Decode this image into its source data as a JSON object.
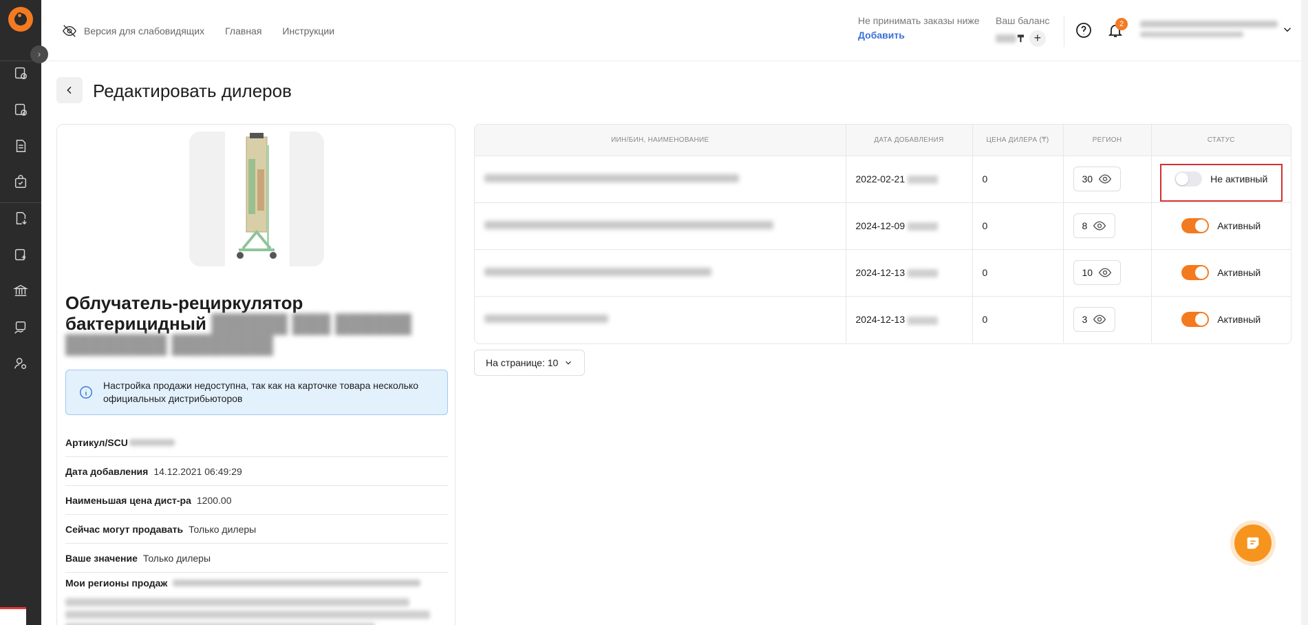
{
  "header": {
    "accessibility_label": "Версия для слабовидящих",
    "nav": [
      "Главная",
      "Инструкции"
    ],
    "min_orders_label": "Не принимать заказы ниже",
    "min_orders_link": "Добавить",
    "balance_label": "Ваш баланс",
    "balance_currency": "₸",
    "notification_count": "2"
  },
  "page": {
    "title": "Редактировать дилеров"
  },
  "product": {
    "name_visible": "Облучатель-рециркулятор бактерицидный",
    "info_text": "Настройка продажи недоступна, так как на карточке товара несколько официальных дистрибьюторов",
    "attributes": [
      {
        "label": "Артикул/SCU",
        "value": ""
      },
      {
        "label": "Дата добавления",
        "value": "14.12.2021 06:49:29"
      },
      {
        "label": "Наименьшая цена дист-ра",
        "value": "1200.00"
      },
      {
        "label": "Сейчас могут продавать",
        "value": "Только дилеры"
      },
      {
        "label": "Ваше значение",
        "value": "Только дилеры"
      },
      {
        "label": "Мои регионы продаж",
        "value": ""
      }
    ]
  },
  "table": {
    "columns": [
      "ИИН/БИН, НАИМЕНОВАНИЕ",
      "ДАТА ДОБАВЛЕНИЯ",
      "ЦЕНА ДИЛЕРА (₸)",
      "РЕГИОН",
      "СТАТУС"
    ],
    "rows": [
      {
        "date": "2022-02-21",
        "price": "0",
        "region": "30",
        "active": false,
        "status": "Не активный"
      },
      {
        "date": "2024-12-09",
        "price": "0",
        "region": "8",
        "active": true,
        "status": "Активный"
      },
      {
        "date": "2024-12-13",
        "price": "0",
        "region": "10",
        "active": true,
        "status": "Активный"
      },
      {
        "date": "2024-12-13",
        "price": "0",
        "region": "3",
        "active": true,
        "status": "Активный"
      }
    ]
  },
  "pagination": {
    "per_page_label": "На странице: 10"
  },
  "colors": {
    "accent": "#f47a20",
    "link": "#3b6fd8",
    "sidebar": "#2b2b2b"
  }
}
